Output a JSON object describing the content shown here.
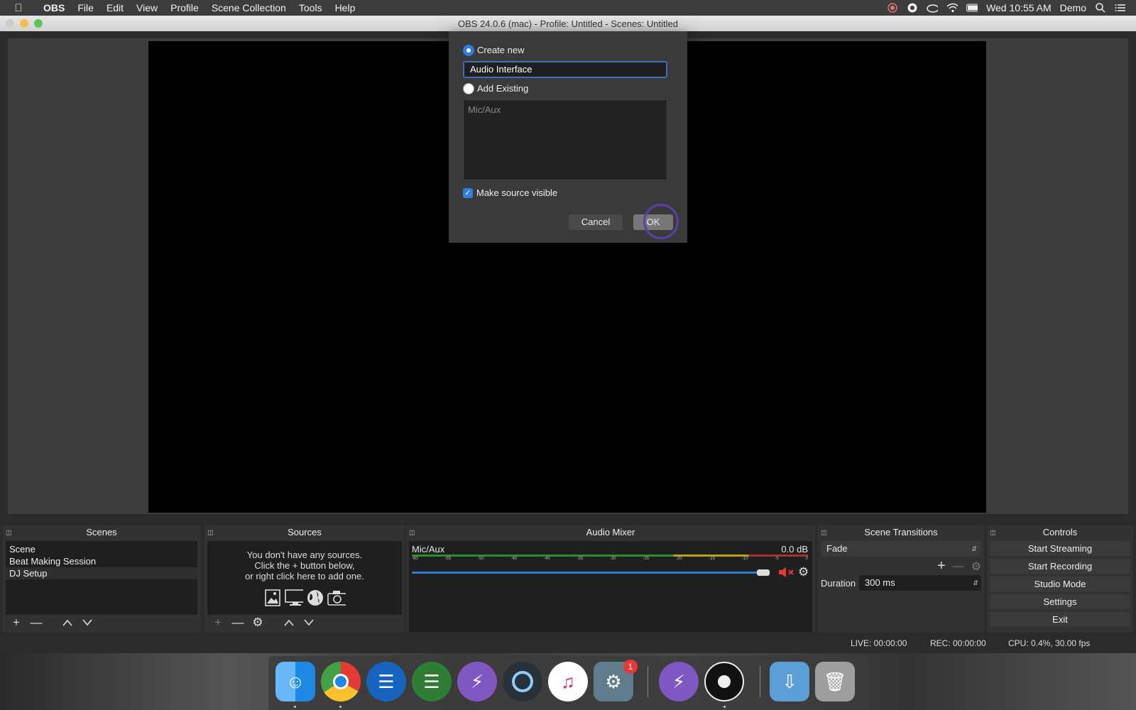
{
  "menubar": {
    "app_name": "OBS",
    "items": [
      "File",
      "Edit",
      "View",
      "Profile",
      "Scene Collection",
      "Tools",
      "Help"
    ],
    "clock": "Wed 10:55 AM",
    "user": "Demo"
  },
  "window": {
    "title": "OBS 24.0.6 (mac) - Profile: Untitled - Scenes: Untitled"
  },
  "dialog": {
    "create_new_label": "Create new",
    "create_new_value": "Audio Interface",
    "add_existing_label": "Add Existing",
    "existing_items": [
      "Mic/Aux"
    ],
    "make_visible_label": "Make source visible",
    "make_visible_checked": true,
    "cancel_label": "Cancel",
    "ok_label": "OK"
  },
  "scenes": {
    "title": "Scenes",
    "items": [
      "Scene",
      "Beat Making Session",
      "DJ Setup"
    ],
    "selected": "DJ Setup"
  },
  "sources": {
    "title": "Sources",
    "empty_line1": "You don't have any sources.",
    "empty_line2": "Click the + button below,",
    "empty_line3": "or right click here to add one."
  },
  "mixer": {
    "title": "Audio Mixer",
    "channel_name": "Mic/Aux",
    "level": "0.0 dB",
    "ticks": [
      "-60",
      "-55",
      "-50",
      "-45",
      "-40",
      "-35",
      "-30",
      "-25",
      "-20",
      "-15",
      "-10",
      "-5",
      "0"
    ]
  },
  "transitions": {
    "title": "Scene Transitions",
    "selected": "Fade",
    "duration_label": "Duration",
    "duration_value": "300 ms"
  },
  "controls": {
    "title": "Controls",
    "start_streaming": "Start Streaming",
    "start_recording": "Start Recording",
    "studio_mode": "Studio Mode",
    "settings": "Settings",
    "exit": "Exit"
  },
  "status": {
    "live": "LIVE: 00:00:00",
    "rec": "REC: 00:00:00",
    "cpu": "CPU: 0.4%, 30.00 fps"
  },
  "dock": {
    "notification_badge": "1"
  }
}
